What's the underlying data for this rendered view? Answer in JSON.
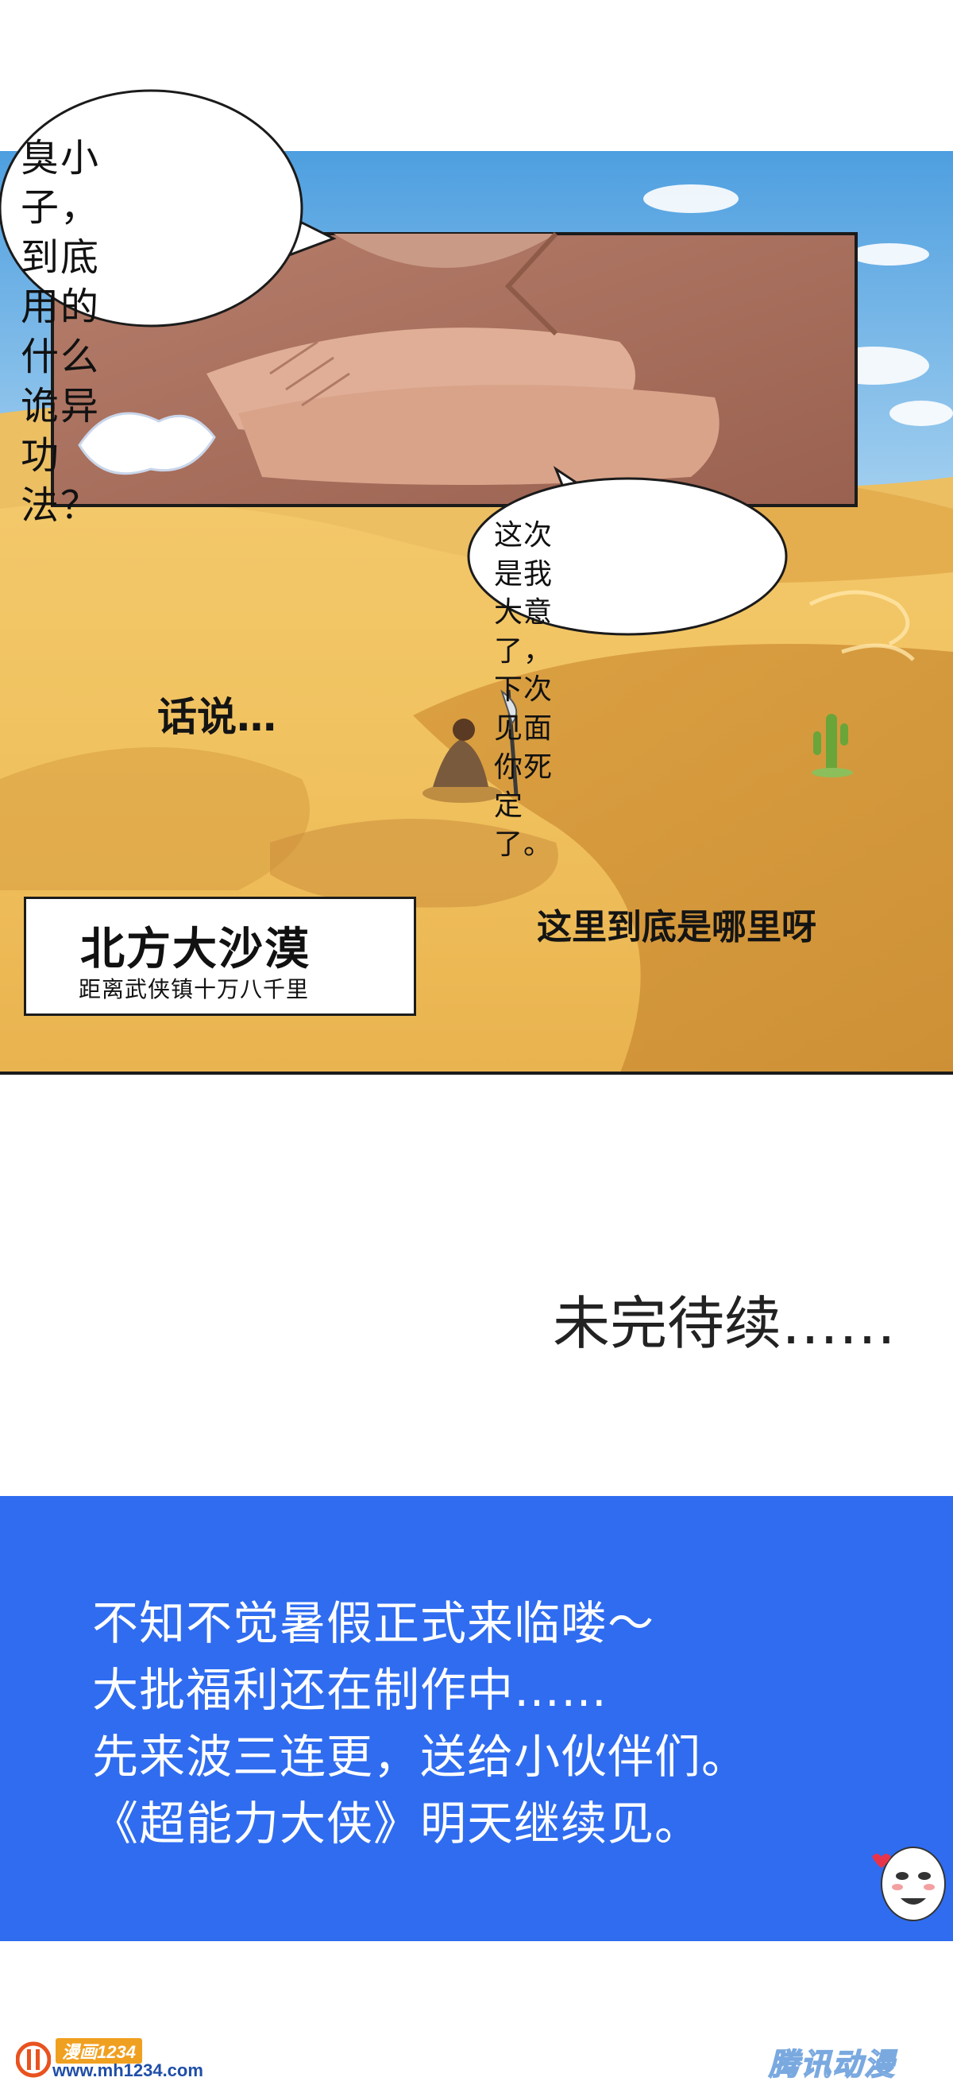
{
  "panel": {
    "bubble_top": "臭小子，到底\n用的什么诡异\n功法？",
    "bubble_bottom": "这次是我大意了，\n下次见面你死定了。",
    "narration_1": "话说…",
    "narration_2": "这里到底是哪里呀",
    "location_title": "北方大沙漠",
    "location_subtitle": "距离武侠镇十万八千里"
  },
  "tbc": "未完待续……",
  "notice": {
    "lines": [
      "不知不觉暑假正式来临喽～",
      "大批福利还在制作中……",
      "先来波三连更，送给小伙伴们。",
      "《超能力大侠》明天继续见。"
    ],
    "background_color": "#2f6cf0"
  },
  "footer": {
    "logo_text": "漫画1234",
    "logo_url": "www.mh1234.com",
    "watermark": "腾讯动漫"
  }
}
